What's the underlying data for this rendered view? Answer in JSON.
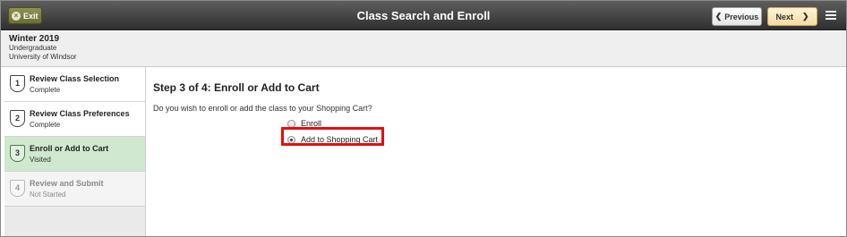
{
  "banner": {
    "title": "Class Search and Enroll",
    "exit_label": "Exit",
    "exit_icon": "×",
    "previous_label": "Previous",
    "next_label": "Next"
  },
  "context": {
    "term": "Winter 2019",
    "career": "Undergraduate",
    "institution": "University of Windsor"
  },
  "steps": [
    {
      "number": "1",
      "title": "Review Class Selection",
      "status": "Complete"
    },
    {
      "number": "2",
      "title": "Review Class Preferences",
      "status": "Complete"
    },
    {
      "number": "3",
      "title": "Enroll or Add to Cart",
      "status": "Visited"
    },
    {
      "number": "4",
      "title": "Review and Submit",
      "status": "Not Started"
    }
  ],
  "main": {
    "heading": "Step 3 of 4: Enroll or Add to Cart",
    "question": "Do you wish to enroll or add the class to your Shopping Cart?",
    "options": [
      {
        "label": "Enroll",
        "selected": false
      },
      {
        "label": "Add to Shopping Cart",
        "selected": true
      }
    ]
  },
  "colors": {
    "banner": "#3d3d3d",
    "current_step": "#cfe8cf",
    "next_button": "#f6dca3",
    "highlight": "#e01010"
  }
}
